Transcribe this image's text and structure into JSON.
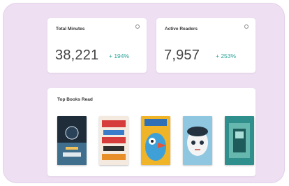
{
  "stats": [
    {
      "title": "Total Minutes",
      "value": "38,221",
      "change": "+ 194%"
    },
    {
      "title": "Active Readers",
      "value": "7,957",
      "change": "+ 253%"
    }
  ],
  "top_books": {
    "title": "Top Books Read",
    "books": [
      {
        "name": "book-cover-1",
        "colors": [
          "#1f2d3a",
          "#3f6f8c",
          "#f2c15a"
        ]
      },
      {
        "name": "book-cover-2",
        "colors": [
          "#f4eadf",
          "#d63c3c",
          "#3a7cc9"
        ]
      },
      {
        "name": "book-cover-3",
        "colors": [
          "#f0b428",
          "#3fa0d8",
          "#e4553a"
        ]
      },
      {
        "name": "book-cover-4",
        "colors": [
          "#8fc6e0",
          "#f4f4f4",
          "#23323e"
        ]
      },
      {
        "name": "book-cover-5",
        "colors": [
          "#2f8f8c",
          "#7ec9be",
          "#1d5c5a"
        ]
      }
    ]
  },
  "colors": {
    "background": "#eedff2",
    "card": "#ffffff",
    "positive": "#2aa39a"
  }
}
